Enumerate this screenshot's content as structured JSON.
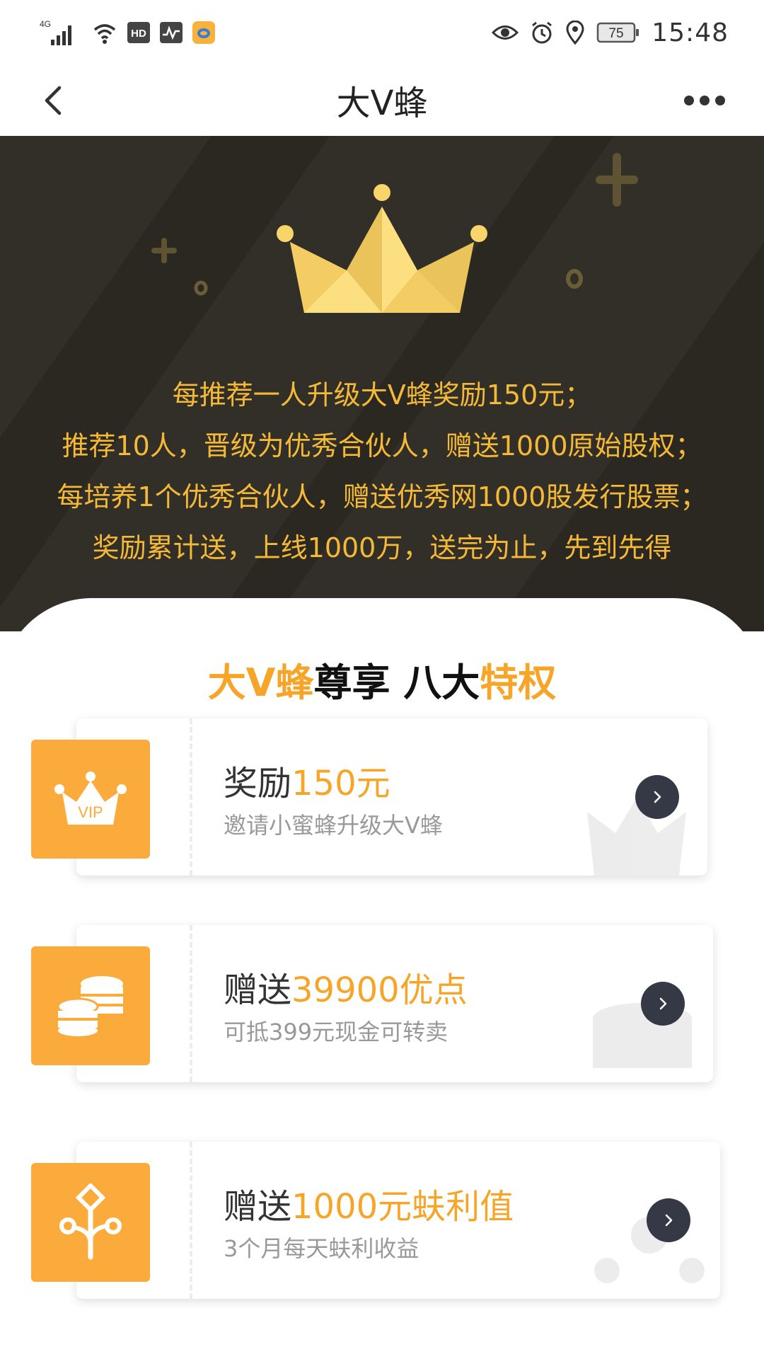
{
  "status_bar": {
    "network": "4G",
    "hd_label": "HD",
    "battery": "75",
    "time": "15:48",
    "icons": [
      "signal-icon",
      "wifi-icon",
      "hd-icon",
      "activity-icon",
      "app-notification-icon",
      "eye-icon",
      "alarm-icon",
      "location-icon",
      "battery-icon"
    ]
  },
  "nav": {
    "title": "大V蜂",
    "back_icon": "chevron-left-icon",
    "more_icon": "more-dots-icon"
  },
  "hero": {
    "lines": [
      "每推荐一人升级大V蜂奖励150元；",
      "推荐10人，晋级为优秀合伙人，赠送1000原始股权；",
      "每培养1个优秀合伙人，赠送优秀网1000股发行股票；",
      "奖励累计送，上线1000万，送完为止，先到先得"
    ],
    "text_color": "#f5b938",
    "bg_color": "#2b2822"
  },
  "section": {
    "title_part1": "大V蜂",
    "title_part2": "尊享 八大",
    "title_part3": "特权"
  },
  "cards": [
    {
      "title_prefix": "奖励",
      "title_highlight": "150元",
      "subtitle": "邀请小蜜蜂升级大V蜂",
      "icon": "vip-crown-icon",
      "icon_text": "VIP"
    },
    {
      "title_prefix": "赠送",
      "title_highlight": "39900优点",
      "subtitle": "可抵399元现金可转卖",
      "icon": "coins-icon"
    },
    {
      "title_prefix": "赠送",
      "title_highlight": "1000元蚨利值",
      "subtitle": "3个月每天蚨利收益",
      "icon": "tree-branch-icon"
    }
  ],
  "colors": {
    "accent": "#f7a528",
    "tile": "#fbab3c",
    "arrow_bg": "#353845"
  }
}
